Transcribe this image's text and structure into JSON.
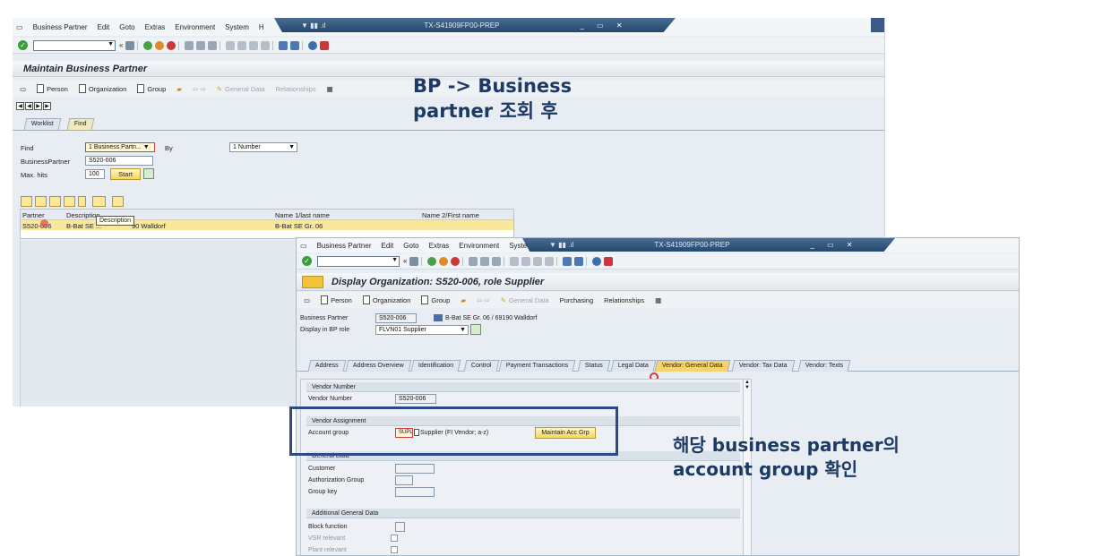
{
  "back_window": {
    "menu": [
      "Business Partner",
      "Edit",
      "Goto",
      "Extras",
      "Environment",
      "System",
      "H"
    ],
    "system_id": "TX-S41909FP00-PREP",
    "title": "Maintain Business Partner",
    "app_toolbar": [
      "Person",
      "Organization",
      "Group",
      "General Data",
      "Relationships"
    ],
    "nav_tabs": [
      "Worklist",
      "Find"
    ],
    "find": {
      "find_label": "Find",
      "find_value": "1 Business Partn...",
      "by_label": "By",
      "by_value": "1 Number",
      "bp_label": "BusinessPartner",
      "bp_value": "S520-006",
      "max_label": "Max. hits",
      "max_value": "100",
      "start_label": "Start"
    },
    "results": {
      "columns": [
        "Partner",
        "Description",
        "Name 1/last name",
        "Name 2/First name"
      ],
      "tooltip": "Description",
      "row": {
        "partner": "S520-006",
        "description": "B-Bat SE ...",
        "description_tail": "90 Walldorf",
        "name1": "B-Bat SE Gr. 06",
        "name2": ""
      }
    }
  },
  "front_window": {
    "menu": [
      "Business Partner",
      "Edit",
      "Goto",
      "Extras",
      "Environment",
      "System",
      "H"
    ],
    "system_id": "TX-S41909FP00-PREP",
    "title": "Display Organization: S520-006, role Supplier",
    "app_toolbar": [
      "Person",
      "Organization",
      "Group",
      "General Data",
      "Purchasing",
      "Relationships"
    ],
    "bp_label": "Business Partner",
    "bp_value": "S520-006",
    "bp_desc": "B-Bat SE Gr. 06 / 69190 Walldorf",
    "role_label": "Display in BP role",
    "role_value": "FLVN01 Supplier",
    "tabs": [
      "Address",
      "Address Overview",
      "Identification",
      "Control",
      "Payment Transactions",
      "Status",
      "Legal Data",
      "Vendor: General Data",
      "Vendor: Tax Data",
      "Vendor: Texts"
    ],
    "active_tab": "Vendor: General Data",
    "vendor_number_section": "Vendor Number",
    "vendor_number_label": "Vendor Number",
    "vendor_number_value": "S520-006",
    "vendor_assign_section": "Vendor Assignment",
    "account_group_label": "Account group",
    "account_group_value": "SUPL",
    "account_group_desc": "Supplier (FI Vendor; a-z)",
    "maintain_btn": "Maintain Acc Grp",
    "general_section": "General Data",
    "general_fields": [
      "Customer",
      "Authorization Group",
      "Group key"
    ],
    "additional_section": "Additional General Data",
    "additional_fields": [
      "Block function",
      "VSR relevant",
      "Plant relevant"
    ]
  },
  "annotations": {
    "note1_line1": "BP -> Business",
    "note1_line2": "partner 조회 후",
    "note2_line1": "해당 business partner의",
    "note2_line2": "account group 확인",
    "highlight_color": "#2e4a86"
  }
}
